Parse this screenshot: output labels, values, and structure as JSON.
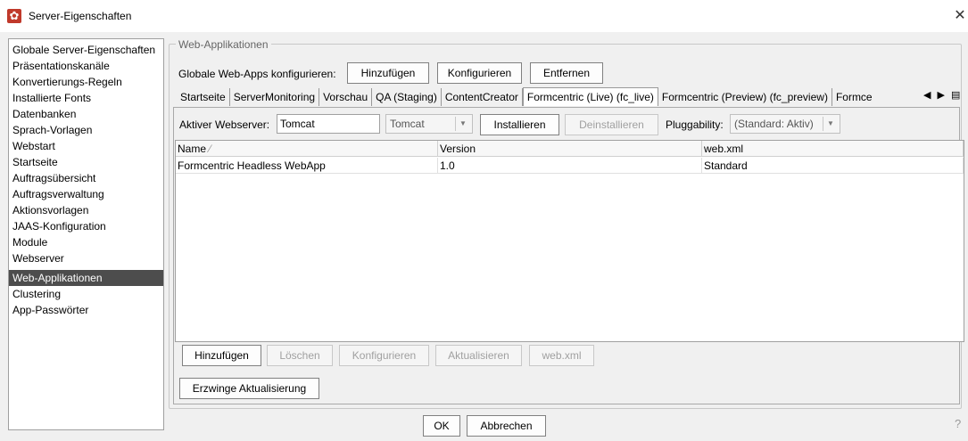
{
  "window": {
    "title": "Server-Eigenschaften",
    "close_glyph": "✕",
    "help_glyph": "?"
  },
  "sidebar": {
    "items": [
      "Globale Server-Eigenschaften",
      "Präsentationskanäle",
      "Konvertierungs-Regeln",
      "Installierte Fonts",
      "Datenbanken",
      "Sprach-Vorlagen",
      "Webstart",
      "Startseite",
      "Auftragsübersicht",
      "Auftragsverwaltung",
      "Aktionsvorlagen",
      "JAAS-Konfiguration",
      "Module",
      "Webserver",
      "Web-Applikationen",
      "Clustering",
      "App-Passwörter"
    ],
    "selected": "Web-Applikationen"
  },
  "group": {
    "legend": "Web-Applikationen",
    "global_label": "Globale Web-Apps konfigurieren:",
    "global_add": "Hinzufügen",
    "global_configure": "Konfigurieren",
    "global_remove": "Entfernen"
  },
  "tabs": {
    "items": [
      "Startseite",
      "ServerMonitoring",
      "Vorschau",
      "QA (Staging)",
      "ContentCreator",
      "Formcentric (Live) (fc_live)",
      "Formcentric (Preview) (fc_preview)",
      "Formce"
    ],
    "active": "Formcentric (Live) (fc_live)",
    "nav_glyphs": "◀ ▶ ▤"
  },
  "panel": {
    "webserver_label": "Aktiver Webserver:",
    "webserver_value": "Tomcat",
    "webserver_combo": "Tomcat",
    "install": "Installieren",
    "uninstall": "Deinstallieren",
    "pluggability_label": "Pluggability:",
    "pluggability_value": "(Standard: Aktiv)"
  },
  "table": {
    "columns": [
      "Name",
      "Version",
      "web.xml"
    ],
    "sort_glyph": "⁄",
    "rows": [
      [
        "Formcentric Headless WebApp",
        "1.0",
        "Standard"
      ]
    ]
  },
  "actions": {
    "add": "Hinzufügen",
    "delete": "Löschen",
    "configure": "Konfigurieren",
    "update": "Aktualisieren",
    "webxml": "web.xml",
    "force_update": "Erzwinge Aktualisierung"
  },
  "footer": {
    "ok": "OK",
    "cancel": "Abbrechen"
  }
}
